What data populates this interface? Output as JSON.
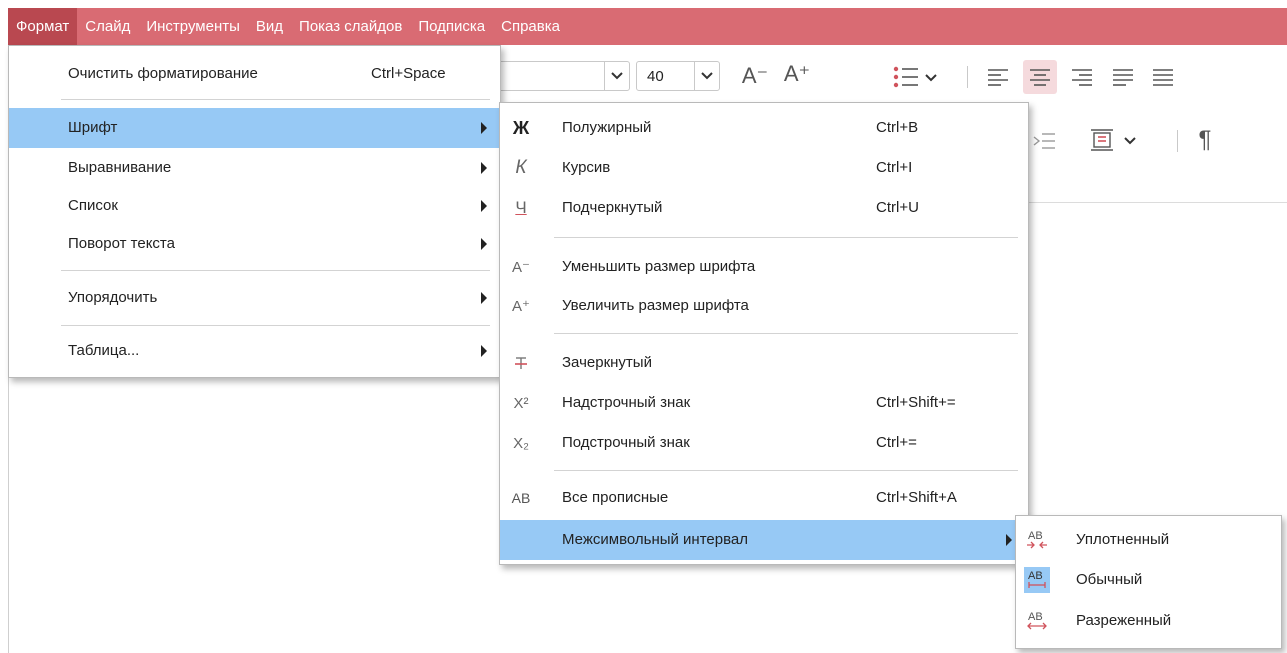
{
  "menubar": {
    "items": [
      "Формат",
      "Слайд",
      "Инструменты",
      "Вид",
      "Показ слайдов",
      "Подписка",
      "Справка"
    ]
  },
  "toolbar": {
    "font_size": "40",
    "decrease_font_glyph": "A⁻",
    "increase_font_glyph": "A⁺",
    "paragraph_glyph": "¶"
  },
  "format_menu": {
    "clear_formatting": {
      "label": "Очистить форматирование",
      "shortcut": "Ctrl+Space"
    },
    "font": {
      "label": "Шрифт"
    },
    "alignment": {
      "label": "Выравнивание"
    },
    "list": {
      "label": "Список"
    },
    "text_rotation": {
      "label": "Поворот текста"
    },
    "arrange": {
      "label": "Упорядочить"
    },
    "table": {
      "label": "Таблица..."
    }
  },
  "font_menu": {
    "bold": {
      "icon_glyph": "Ж",
      "label": "Полужирный",
      "shortcut": "Ctrl+B"
    },
    "italic": {
      "icon_glyph": "К",
      "label": "Курсив",
      "shortcut": "Ctrl+I"
    },
    "underline": {
      "icon_glyph": "Ч",
      "label": "Подчеркнутый",
      "shortcut": "Ctrl+U"
    },
    "decrease_size": {
      "icon_glyph": "A⁻",
      "label": "Уменьшить размер шрифта"
    },
    "increase_size": {
      "icon_glyph": "A⁺",
      "label": "Увеличить размер шрифта"
    },
    "strikethrough": {
      "label": "Зачеркнутый"
    },
    "superscript": {
      "icon_glyph": "X²",
      "label": "Надстрочный знак",
      "shortcut": "Ctrl+Shift+="
    },
    "subscript": {
      "icon_glyph": "X₂",
      "label": "Подстрочный знак",
      "shortcut": "Ctrl+="
    },
    "all_caps": {
      "icon_glyph": "AB",
      "label": "Все прописные",
      "shortcut": "Ctrl+Shift+A"
    },
    "char_spacing": {
      "label": "Межсимвольный интервал"
    }
  },
  "spacing_menu": {
    "condensed": {
      "label": "Уплотненный"
    },
    "normal": {
      "label": "Обычный"
    },
    "expanded": {
      "label": "Разреженный"
    }
  },
  "colors": {
    "menubar_bg": "#d96b73",
    "menubar_active": "#b94850",
    "highlight": "#97c9f5",
    "accent_red": "#d0535c"
  }
}
